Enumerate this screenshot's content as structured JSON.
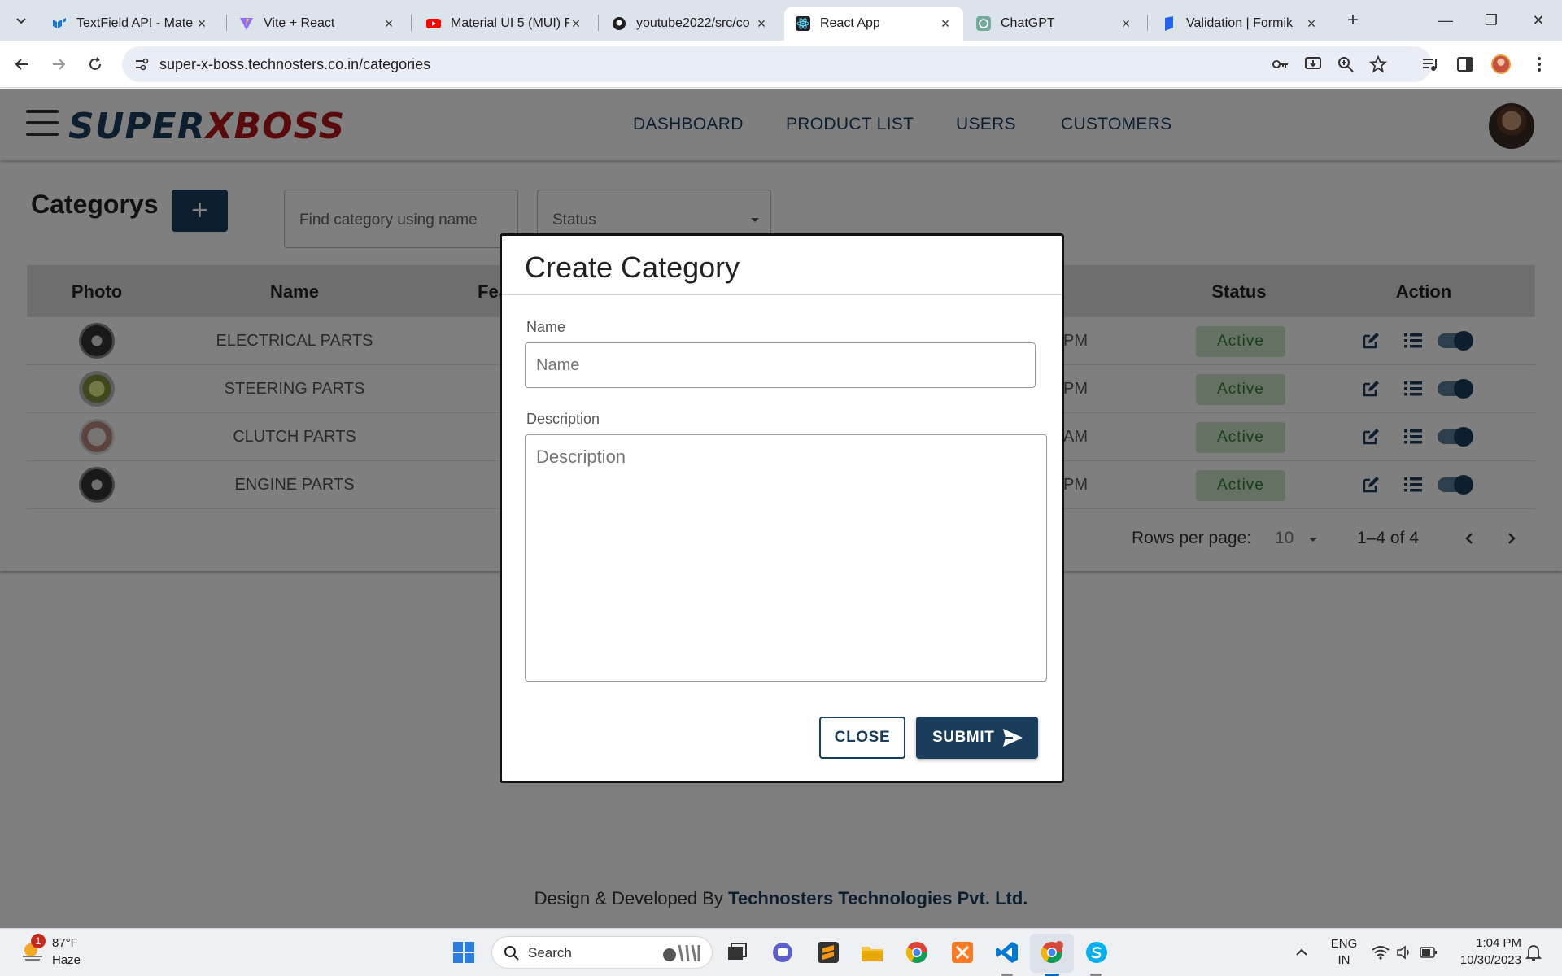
{
  "browser": {
    "tabs": [
      {
        "title": "TextField API - Mate",
        "icon": "mui-icon"
      },
      {
        "title": "Vite + React",
        "icon": "vite-icon"
      },
      {
        "title": "Material UI 5 (MUI) F",
        "icon": "youtube-icon"
      },
      {
        "title": "youtube2022/src/co",
        "icon": "github-icon"
      },
      {
        "title": "React App",
        "icon": "react-icon",
        "active": true
      },
      {
        "title": "ChatGPT",
        "icon": "chatgpt-icon"
      },
      {
        "title": "Validation | Formik",
        "icon": "formik-icon"
      }
    ],
    "url": "super-x-boss.technosters.co.in/categories"
  },
  "app": {
    "logo": {
      "part1": "SUPER",
      "part2": "X",
      "part3": "BOSS"
    },
    "nav": [
      "DASHBOARD",
      "PRODUCT LIST",
      "USERS",
      "CUSTOMERS"
    ]
  },
  "page": {
    "title": "Categorys",
    "add_label": "+",
    "search_placeholder": "Find category using name",
    "status_placeholder": "Status",
    "columns": [
      "Photo",
      "Name",
      "Fea",
      "Status",
      "Action"
    ],
    "rows": [
      {
        "name": "ELECTRICAL PARTS",
        "time": "PM",
        "status": "Active"
      },
      {
        "name": "STEERING PARTS",
        "time": "PM",
        "status": "Active"
      },
      {
        "name": "CLUTCH PARTS",
        "time": "AM",
        "status": "Active"
      },
      {
        "name": "ENGINE PARTS",
        "time": "PM",
        "status": "Active"
      }
    ],
    "pagination": {
      "rows_per_page_label": "Rows per page:",
      "rows_per_page": "10",
      "range": "1–4 of 4"
    },
    "footer": {
      "prefix": "Design & Developed By",
      "company": "Technosters Technologies Pvt. Ltd."
    }
  },
  "modal": {
    "title": "Create Category",
    "name_label": "Name",
    "name_placeholder": "Name",
    "description_label": "Description",
    "description_placeholder": "Description",
    "close_label": "CLOSE",
    "submit_label": "SUBMIT"
  },
  "taskbar": {
    "weather_badge": "1",
    "temperature": "87°F",
    "condition": "Haze",
    "search_label": "Search",
    "language": "ENG",
    "region": "IN",
    "time": "1:04 PM",
    "date": "10/30/2023"
  },
  "colors": {
    "primary": "#1b3d5c",
    "accent_red": "#b3151b",
    "active_bg": "#c9e3c6",
    "active_text": "#2e7d32"
  }
}
